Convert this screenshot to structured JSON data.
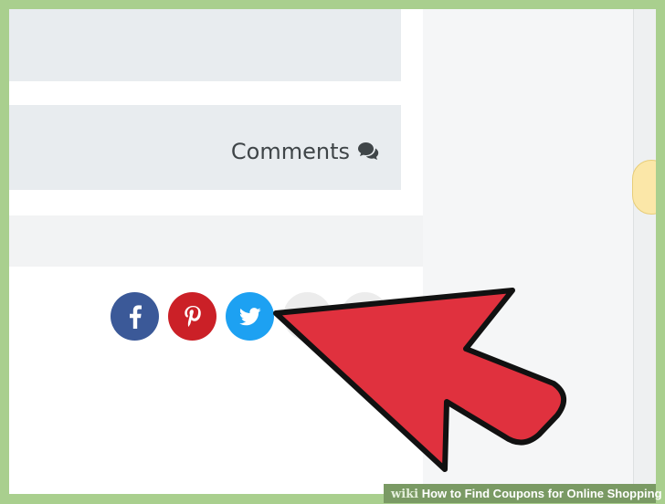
{
  "comments": {
    "label": "Comments",
    "icon": "comments-icon"
  },
  "share": {
    "buttons": [
      {
        "name": "facebook",
        "icon": "facebook-icon",
        "color": "#3b5998"
      },
      {
        "name": "pinterest",
        "icon": "pinterest-icon",
        "color": "#cb2027"
      },
      {
        "name": "twitter",
        "icon": "twitter-icon",
        "color": "#1da1f2"
      }
    ]
  },
  "annotation": {
    "type": "pointer-arrow",
    "color": "#e0313e"
  },
  "caption": {
    "brand": "wiki",
    "title": "How to Find Coupons for Online Shopping"
  },
  "colors": {
    "frame": "#a9cf8e",
    "panel": "#e8ecef",
    "accent": "#e0313e"
  }
}
